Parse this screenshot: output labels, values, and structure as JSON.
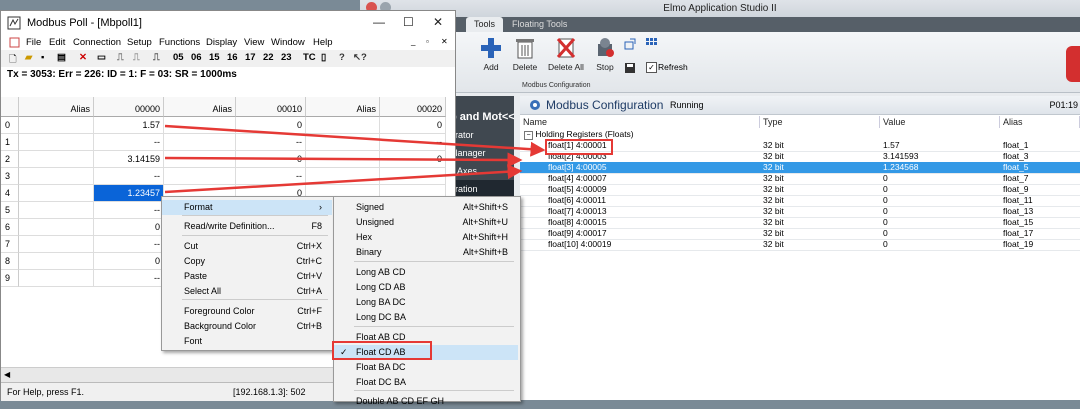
{
  "elmo": {
    "title": "Elmo Application Studio II",
    "tabs": [
      "Tools",
      "Floating Tools"
    ],
    "ribbon": {
      "buttons": [
        "Add",
        "Delete",
        "Delete All",
        "Stop"
      ],
      "refresh_label": "Refresh",
      "refresh_checked": true,
      "group_label": "Modbus Configuration"
    },
    "nav": [
      "p and Mot<<",
      "urator",
      "Manager",
      "p Axes",
      "uration"
    ],
    "config": {
      "title": "Modbus Configuration",
      "status": "Running",
      "node": "P01:19",
      "columns": [
        "Name",
        "Type",
        "Value",
        "Alias"
      ],
      "group": "Holding Registers (Floats)",
      "rows": [
        {
          "name": "float[1] 4:00001",
          "type": "32 bit",
          "value": "1.57",
          "alias": "float_1"
        },
        {
          "name": "float[2] 4:00003",
          "type": "32 bit",
          "value": "3.141593",
          "alias": "float_3"
        },
        {
          "name": "float[3] 4:00005",
          "type": "32 bit",
          "value": "1.234568",
          "alias": "float_5"
        },
        {
          "name": "float[4] 4:00007",
          "type": "32 bit",
          "value": "0",
          "alias": "float_7"
        },
        {
          "name": "float[5] 4:00009",
          "type": "32 bit",
          "value": "0",
          "alias": "float_9"
        },
        {
          "name": "float[6] 4:00011",
          "type": "32 bit",
          "value": "0",
          "alias": "float_11"
        },
        {
          "name": "float[7] 4:00013",
          "type": "32 bit",
          "value": "0",
          "alias": "float_13"
        },
        {
          "name": "float[8] 4:00015",
          "type": "32 bit",
          "value": "0",
          "alias": "float_15"
        },
        {
          "name": "float[9] 4:00017",
          "type": "32 bit",
          "value": "0",
          "alias": "float_17"
        },
        {
          "name": "float[10] 4:00019",
          "type": "32 bit",
          "value": "0",
          "alias": "float_19"
        }
      ]
    }
  },
  "modbus_poll": {
    "title": "Modbus Poll - [Mbpoll1]",
    "menu": [
      "File",
      "Edit",
      "Connection",
      "Setup",
      "Functions",
      "Display",
      "View",
      "Window",
      "Help"
    ],
    "toolbar_codes": [
      "05",
      "06",
      "15",
      "16",
      "17",
      "22",
      "23",
      "TC"
    ],
    "info": "Tx = 3053: Err = 226: ID = 1: F = 03: SR = 1000ms",
    "headers": [
      "Alias",
      "00000",
      "Alias",
      "00010",
      "Alias",
      "00020"
    ],
    "row_numbers": [
      "0",
      "1",
      "2",
      "3",
      "4",
      "5",
      "6",
      "7",
      "8",
      "9"
    ],
    "col1": [
      "1.57",
      "--",
      "3.14159",
      "--",
      "1.23457",
      "--",
      "0",
      "--",
      "0",
      "--"
    ],
    "col2": [
      "0",
      "--",
      "0",
      "--",
      "0"
    ],
    "col3": [
      "0",
      "--",
      "0",
      "--"
    ],
    "status_left": "For Help, press F1.",
    "status_right": "[192.168.1.3]: 502"
  },
  "context_menu": {
    "items": [
      {
        "label": "Format",
        "shortcut": ""
      },
      {
        "label": "Read/write Definition...",
        "shortcut": "F8"
      },
      {
        "label": "Cut",
        "shortcut": "Ctrl+X"
      },
      {
        "label": "Copy",
        "shortcut": "Ctrl+C"
      },
      {
        "label": "Paste",
        "shortcut": "Ctrl+V"
      },
      {
        "label": "Select All",
        "shortcut": "Ctrl+A"
      },
      {
        "label": "Foreground Color",
        "shortcut": "Ctrl+F"
      },
      {
        "label": "Background Color",
        "shortcut": "Ctrl+B"
      },
      {
        "label": "Font",
        "shortcut": ""
      }
    ]
  },
  "format_menu": {
    "items": [
      {
        "label": "Signed",
        "shortcut": "Alt+Shift+S"
      },
      {
        "label": "Unsigned",
        "shortcut": "Alt+Shift+U"
      },
      {
        "label": "Hex",
        "shortcut": "Alt+Shift+H"
      },
      {
        "label": "Binary",
        "shortcut": "Alt+Shift+B"
      },
      {
        "label": "Long AB CD",
        "shortcut": ""
      },
      {
        "label": "Long CD AB",
        "shortcut": ""
      },
      {
        "label": "Long BA DC",
        "shortcut": ""
      },
      {
        "label": "Long DC BA",
        "shortcut": ""
      },
      {
        "label": "Float AB CD",
        "shortcut": ""
      },
      {
        "label": "Float CD AB",
        "shortcut": ""
      },
      {
        "label": "Float BA DC",
        "shortcut": ""
      },
      {
        "label": "Float DC BA",
        "shortcut": ""
      },
      {
        "label": "Double AB CD EF GH",
        "shortcut": ""
      }
    ],
    "checked": "Float CD AB"
  },
  "colors": {
    "accent": "#0a64d8",
    "selection": "#3399e6",
    "annotation": "#e53935"
  }
}
